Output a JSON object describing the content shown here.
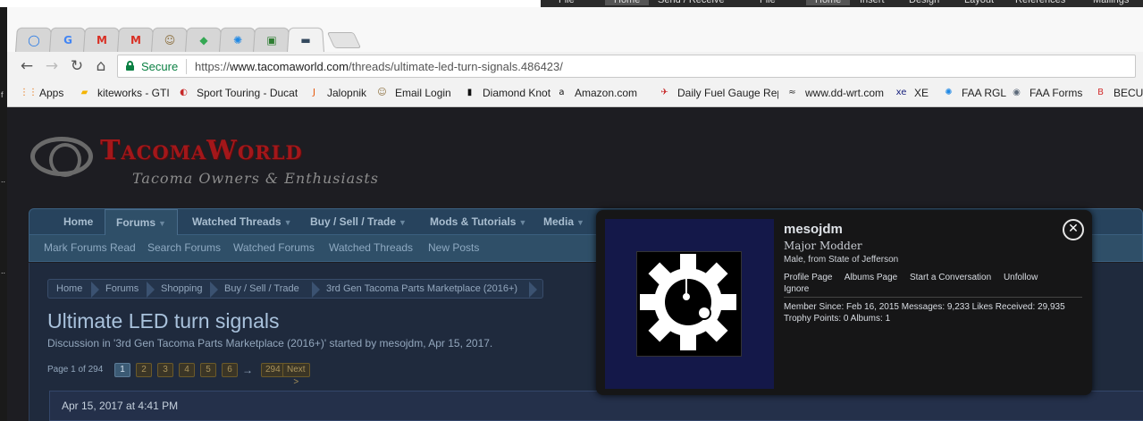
{
  "background_ribbon": {
    "items": [
      "File",
      "Home",
      "Send / Receive",
      "File",
      "Home",
      "Insert",
      "Design",
      "Layout",
      "References",
      "Mailings"
    ],
    "selected": [
      1,
      4
    ]
  },
  "left_edge_fragments": [
    "f",
    "..",
    ".."
  ],
  "browser": {
    "tabs": [
      {
        "icon": "chrome-icon",
        "glyph": "◯",
        "color": "#1a73e8"
      },
      {
        "icon": "contacts-icon",
        "glyph": "G",
        "color": "#4285f4"
      },
      {
        "icon": "gmail-icon",
        "glyph": "M",
        "color": "#d93025"
      },
      {
        "icon": "gmail-icon",
        "glyph": "M",
        "color": "#d93025"
      },
      {
        "icon": "person-icon",
        "glyph": "☺",
        "color": "#8a6d3b"
      },
      {
        "icon": "maps-icon",
        "glyph": "◆",
        "color": "#34a853"
      },
      {
        "icon": "faa-icon",
        "glyph": "✺",
        "color": "#1e88e5"
      },
      {
        "icon": "photo-icon",
        "glyph": "▣",
        "color": "#2e7d32"
      },
      {
        "icon": "tacomaworld-icon",
        "glyph": "▬",
        "color": "#34495e"
      }
    ],
    "secure_label": "Secure",
    "url_prefix": "https://",
    "url_domain": "www.tacomaworld.com",
    "url_path": "/threads/ultimate-led-turn-signals.486423/",
    "bookmarks": [
      {
        "label": "Apps",
        "icon": "apps-grid-icon",
        "glyph": "⋮⋮",
        "color": "#e8710a"
      },
      {
        "label": "kiteworks - GTI",
        "icon": "folder-icon",
        "glyph": "▰",
        "color": "#f4b400"
      },
      {
        "label": "Sport Touring - Ducati",
        "icon": "ducati-icon",
        "glyph": "◐",
        "color": "#c62828"
      },
      {
        "label": "Jalopnik",
        "icon": "jalopnik-icon",
        "glyph": "J",
        "color": "#e65100"
      },
      {
        "label": "Email Login",
        "icon": "person-icon",
        "glyph": "☺",
        "color": "#8a6d3b"
      },
      {
        "label": "Diamond Knot",
        "icon": "bottle-icon",
        "glyph": "▮",
        "color": "#111111"
      },
      {
        "label": "Amazon.com",
        "icon": "amazon-icon",
        "glyph": "a",
        "color": "#111111"
      },
      {
        "label": "Daily Fuel Gauge Rep",
        "icon": "aaa-icon",
        "glyph": "✈",
        "color": "#c62828"
      },
      {
        "label": "www.dd-wrt.com",
        "icon": "ddwrt-icon",
        "glyph": "≈",
        "color": "#333333"
      },
      {
        "label": "XE",
        "icon": "xe-icon",
        "glyph": "xe",
        "color": "#1a237e"
      },
      {
        "label": "FAA RGL",
        "icon": "faa-icon",
        "glyph": "✺",
        "color": "#1e88e5"
      },
      {
        "label": "FAA Forms",
        "icon": "seal-icon",
        "glyph": "◉",
        "color": "#5d6a7a"
      },
      {
        "label": "BECU",
        "icon": "becu-icon",
        "glyph": "B",
        "color": "#d32f2f"
      }
    ]
  },
  "site": {
    "logo_title": "TacomaWorld",
    "logo_subtitle": "Tacoma Owners & Enthusiasts",
    "nav_tabs": [
      {
        "label": "Home",
        "dropdown": false
      },
      {
        "label": "Forums",
        "dropdown": true
      },
      {
        "label": "Watched Threads",
        "dropdown": true
      },
      {
        "label": "Buy / Sell / Trade",
        "dropdown": true
      },
      {
        "label": "Mods & Tutorials",
        "dropdown": true
      },
      {
        "label": "Media",
        "dropdown": true
      }
    ],
    "dropdown_glyph": "▼",
    "active_tab_index": 1,
    "sub_nav": [
      "Mark Forums Read",
      "Search Forums",
      "Watched Forums",
      "Watched Threads",
      "New Posts"
    ],
    "breadcrumbs": [
      "Home",
      "Forums",
      "Shopping",
      "Buy / Sell / Trade",
      "3rd Gen Tacoma Parts Marketplace (2016+)"
    ],
    "thread_title": "Ultimate LED turn signals",
    "thread_meta": "Discussion in '3rd Gen Tacoma Parts Marketplace (2016+)' started by mesojdm, Apr 15, 2017.",
    "pager": {
      "label": "Page 1 of 294",
      "pages": [
        "1",
        "2",
        "3",
        "4",
        "5",
        "6"
      ],
      "current": "1",
      "arrow": "→",
      "last": "294",
      "next": "Next >"
    },
    "post_date": "Apr 15, 2017 at 4:41 PM"
  },
  "profile_popup": {
    "username": "mesojdm",
    "rank": "Major Modder",
    "location": "Male, from State of Jefferson",
    "links": [
      "Profile Page",
      "Albums Page",
      "Start a Conversation",
      "Unfollow",
      "Ignore"
    ],
    "stats": "Member Since: Feb 16, 2015  Messages: 9,233  Likes Received: 29,935  Trophy Points: 0  Albums: 1",
    "close_glyph": "✕",
    "avatar_icon": "gear-icon",
    "avatar_bg": "#141849"
  },
  "colors": {
    "brand_red": "#a3171a",
    "nav_blue": "#27435d",
    "secure_green": "#0b8043"
  }
}
